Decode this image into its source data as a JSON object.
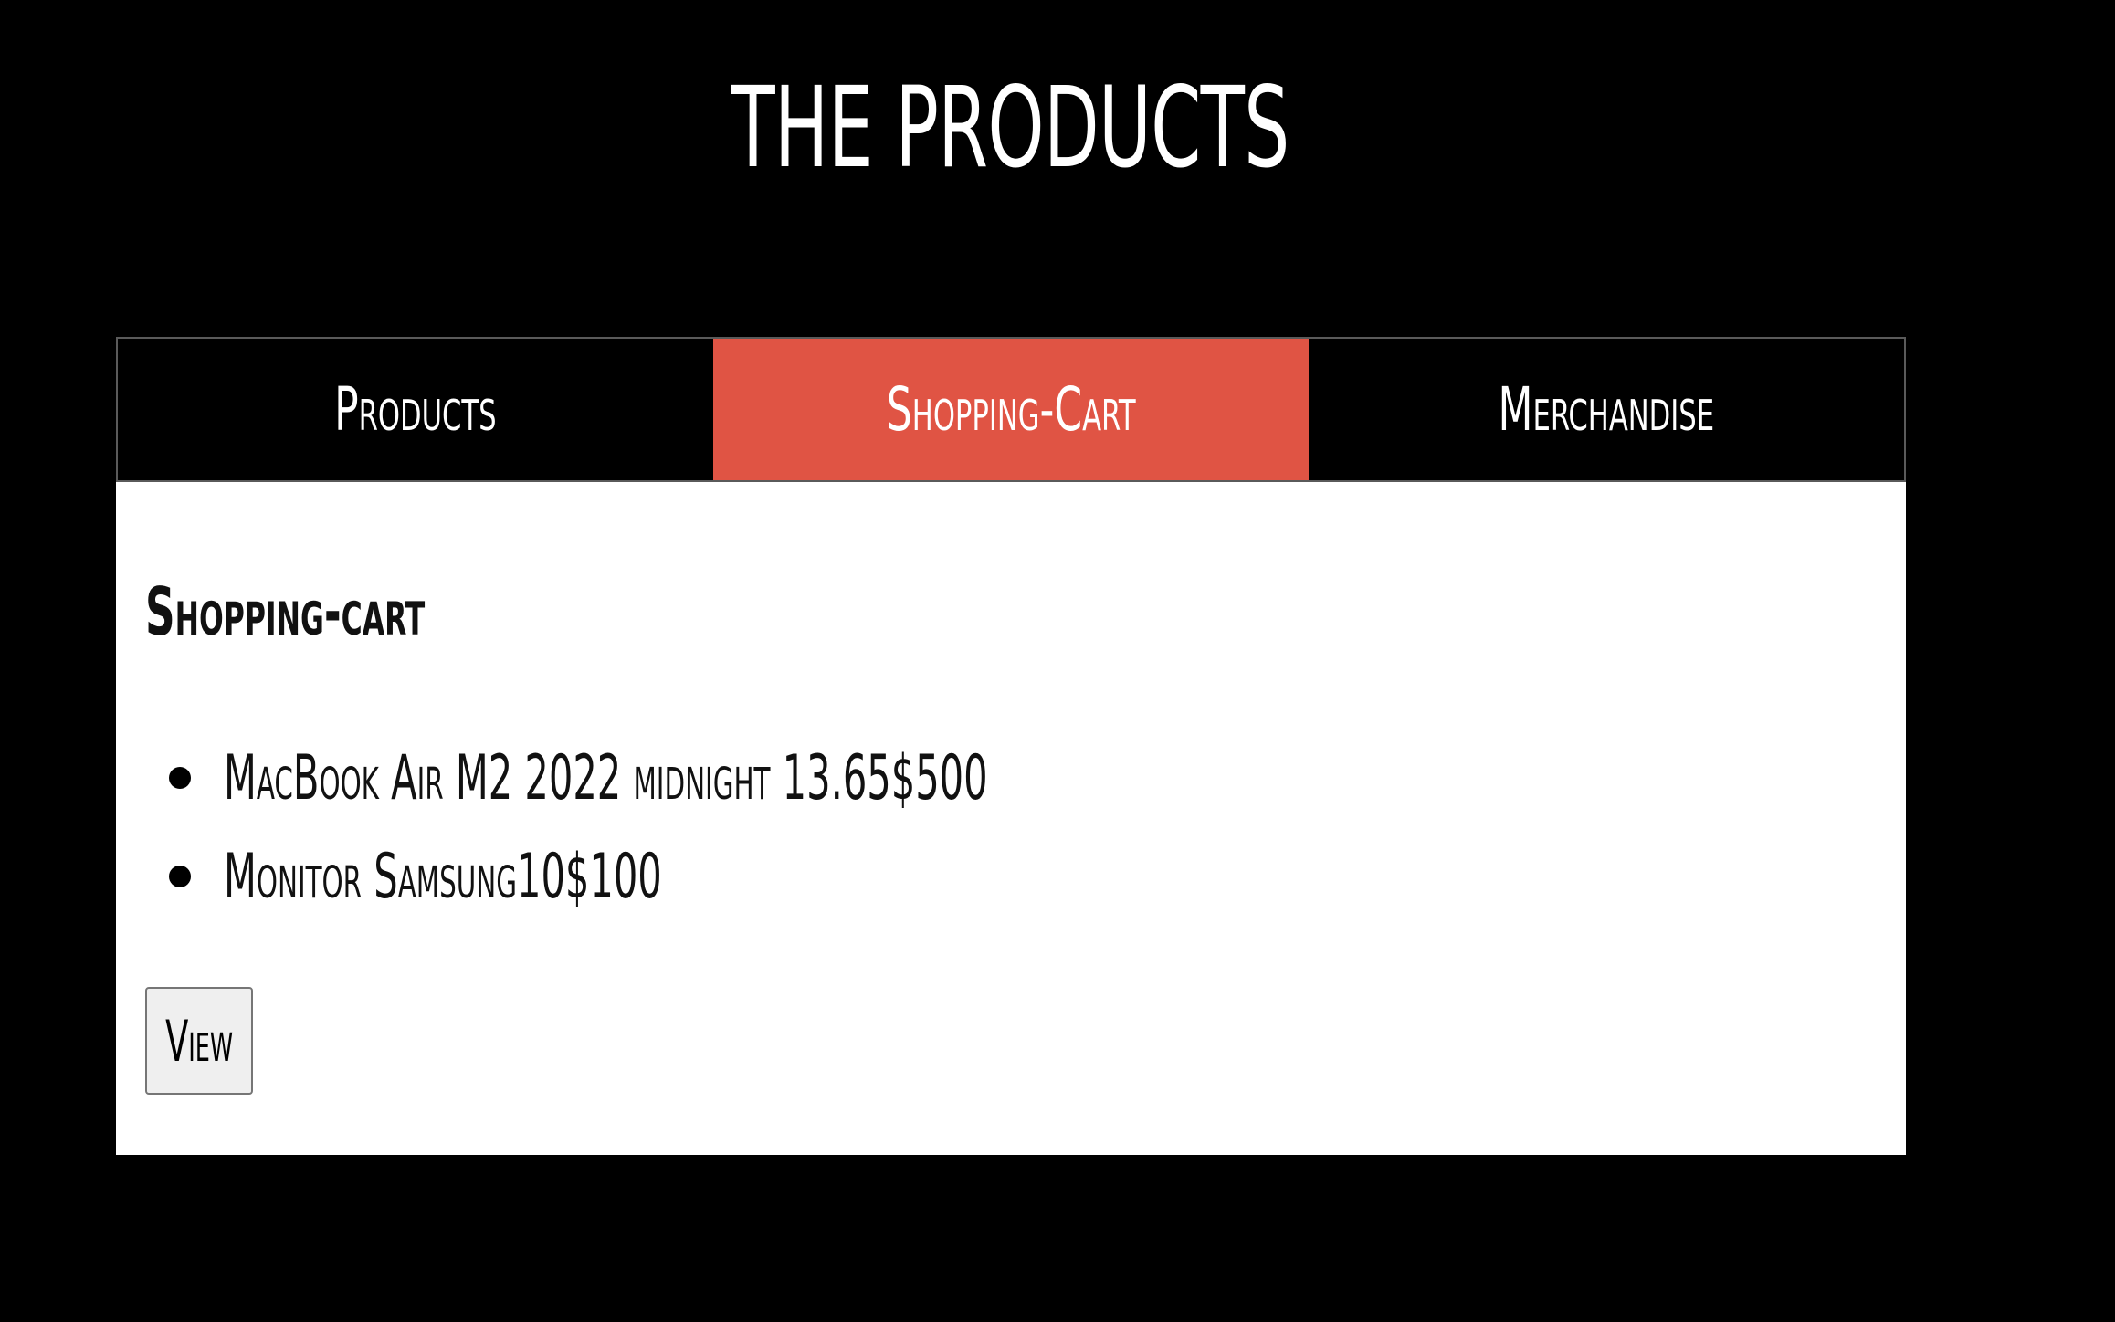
{
  "page": {
    "title": "THE PRODUCTS"
  },
  "tabs": [
    {
      "label": "Products",
      "active": false
    },
    {
      "label": "Shopping-Cart",
      "active": true
    },
    {
      "label": "Merchandise",
      "active": false
    }
  ],
  "cart": {
    "heading": "Shopping-cart",
    "items": [
      {
        "text": "MacBook Air M2 2022 midnight 13.65$500"
      },
      {
        "text": "Monitor Samsung10$100"
      }
    ],
    "view_label": "View"
  },
  "colors": {
    "background": "#000000",
    "active_tab": "#e05444",
    "panel": "#ffffff",
    "tab_border": "#5a5a5a"
  }
}
